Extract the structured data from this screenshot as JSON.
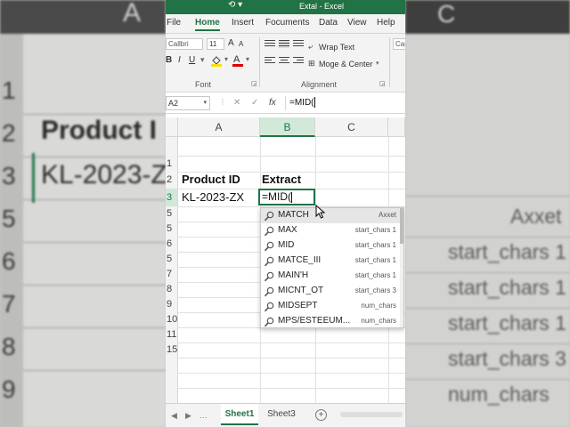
{
  "app": {
    "title": "Extal - Excel"
  },
  "tabs": [
    "File",
    "Home",
    "Insert",
    "Focuments",
    "Data",
    "View",
    "Help"
  ],
  "active_tab": "Home",
  "ribbon": {
    "font_name": "Callbri",
    "font_size": "11",
    "bold": "B",
    "italic": "I",
    "underline": "U",
    "font_group": "Font",
    "wrap_text": "Wrap Text",
    "merge_center": "Moge & Center",
    "alignment_group": "Alignment",
    "styles_cut": "Car"
  },
  "formula_bar": {
    "name_box": "A2",
    "fx": "fx",
    "formula": "=MID("
  },
  "columns": [
    "A",
    "B",
    "C"
  ],
  "rows": [
    "1",
    "2",
    "3",
    "5",
    "5",
    "6",
    "5",
    "7",
    "8",
    "9",
    "10",
    "11",
    "15"
  ],
  "cells": {
    "a2": "Product ID",
    "b2": "Extract",
    "a3": "KL-2023-ZX",
    "b3": "=MID("
  },
  "autocomplete": [
    {
      "name": "MATCH",
      "hint": "Axxet"
    },
    {
      "name": "MAX",
      "hint": "start_chars 1"
    },
    {
      "name": "MID",
      "hint": "start_chars 1"
    },
    {
      "name": "MATCE_III",
      "hint": "start_chars 1"
    },
    {
      "name": "MAIN'H",
      "hint": "start_chars 1"
    },
    {
      "name": "MICNT_OT",
      "hint": "start_chars 3"
    },
    {
      "name": "MIDSEPT",
      "hint": "num_chars"
    },
    {
      "name": "MPS/ESTEEUM...",
      "hint": "num_chars"
    }
  ],
  "sheets": {
    "active": "Sheet1",
    "other": "Sheet3"
  },
  "background": {
    "left_col": "A",
    "left_rownums": [
      "1",
      "2",
      "3",
      "5",
      "6",
      "7",
      "8",
      "9"
    ],
    "left_header": "Product I",
    "left_value": "KL-2023-Z",
    "right_col": "C",
    "right_header": "Axxet",
    "right_items": [
      "start_chars 1",
      "start_chars 1",
      "start_chars 1",
      "start_chars 3",
      "num_chars"
    ]
  },
  "colors": {
    "accent": "#217346"
  }
}
